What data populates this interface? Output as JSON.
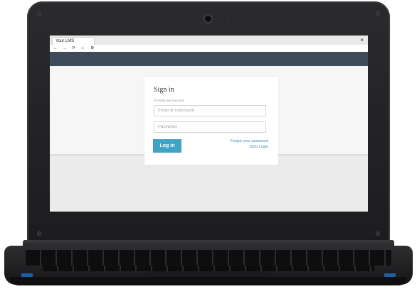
{
  "browser": {
    "tab_title": "Your LMS",
    "close_glyph": "×",
    "toolbar_icons": [
      "back-icon",
      "forward-icon",
      "reload-icon",
      "home-icon",
      "settings-icon"
    ]
  },
  "signin": {
    "title": "Sign in",
    "required_note": "All fields are required",
    "username_placeholder": "Email or Username",
    "password_placeholder": "Password",
    "login_label": "Log in",
    "forgot_label": "Forgot your password",
    "sso_label": "SSO Login"
  },
  "colors": {
    "header_strip": "#3f4b58",
    "login_button": "#3fa3c3",
    "link": "#3a8fb7"
  }
}
